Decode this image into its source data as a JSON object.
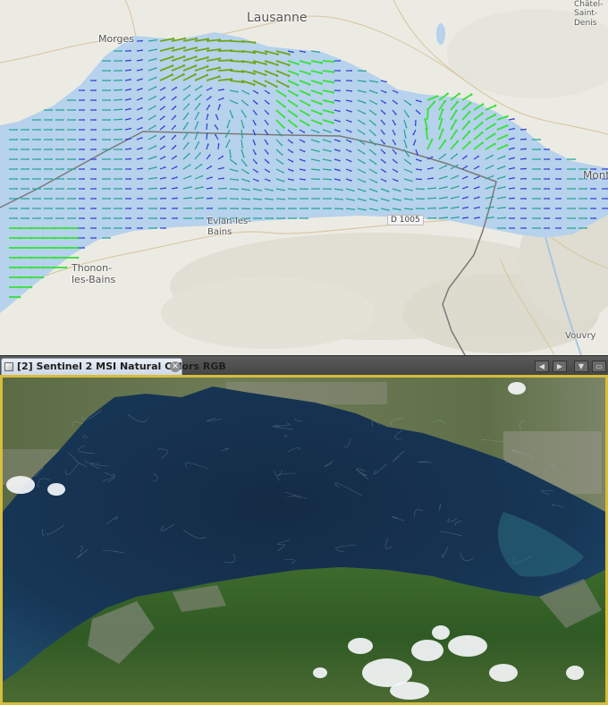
{
  "map": {
    "places": [
      {
        "label": "Lausanne",
        "key": "lausanne"
      },
      {
        "label": "Morges",
        "key": "morges"
      },
      {
        "label": "Châtel-\nSaint-\nDenis",
        "key": "chatel"
      },
      {
        "label": "Mont",
        "key": "mont"
      },
      {
        "label": "Evian-les-\nBains",
        "key": "evian"
      },
      {
        "label": "Thonon-\nles-Bains",
        "key": "thonon"
      },
      {
        "label": "Vouvry",
        "key": "vouvry"
      }
    ],
    "road_label": "D 1005",
    "colors": {
      "land": "#ecebe3",
      "lake": "#b6d2ec",
      "border": "#7a7a7a",
      "arrow_weak": "#2e3fd6",
      "arrow_mid": "#25a29a",
      "arrow_strong": "#39e03c",
      "arrow_strongest": "#6fa61a"
    }
  },
  "viewer": {
    "tab_title": "[2] Sentinel 2 MSI Natural Colors RGB",
    "close_icon": "close-icon",
    "controls": [
      "arrow-left-icon",
      "arrow-right-icon",
      "dropdown-icon",
      "maximize-icon"
    ],
    "frame_color": "#d6bd3c"
  }
}
